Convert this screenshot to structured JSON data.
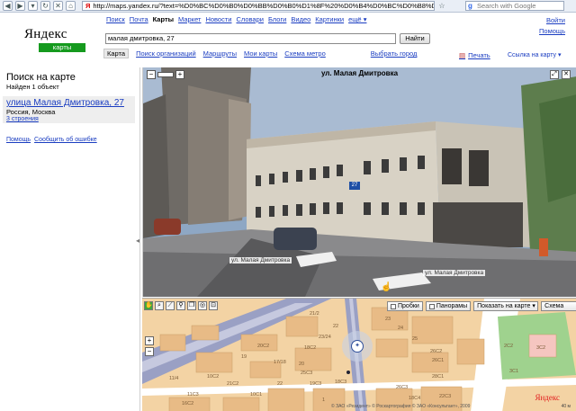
{
  "browser": {
    "url": "http://maps.yandex.ru/?text=%D0%BC%D0%B0%D0%BB%D0%B0%D1%8F%20%D0%B4%D0%BC%D0%B8%D1%82%D1",
    "search_placeholder": "Search with Google",
    "search_engine_letter": "g"
  },
  "header": {
    "services": [
      {
        "label": "Поиск",
        "active": false
      },
      {
        "label": "Почта",
        "active": false
      },
      {
        "label": "Карты",
        "active": true
      },
      {
        "label": "Маркет",
        "active": false
      },
      {
        "label": "Новости",
        "active": false
      },
      {
        "label": "Словари",
        "active": false
      },
      {
        "label": "Блоги",
        "active": false
      },
      {
        "label": "Видео",
        "active": false
      },
      {
        "label": "Картинки",
        "active": false
      },
      {
        "label": "ещё ▾",
        "active": false
      }
    ],
    "login": "Войти",
    "help": "Помощь",
    "logo_word": "Яндекс",
    "logo_sub": "карты"
  },
  "search": {
    "query": "малая дмитровка, 27",
    "button": "Найти"
  },
  "tabs": [
    {
      "label": "Карта",
      "active": true
    },
    {
      "label": "Поиск организаций",
      "active": false
    },
    {
      "label": "Маршруты",
      "active": false
    },
    {
      "label": "Мои карты",
      "active": false
    },
    {
      "label": "Схема метро",
      "active": false
    }
  ],
  "choose_city": "Выбрать город",
  "print": "Печать",
  "link_to_map": "Ссылка на карту ▾",
  "sidebar": {
    "title": "Поиск на карте",
    "found": "Найден 1 объект",
    "result_title": "улица Малая Дмитровка, 27",
    "result_city": "Россия, Москва",
    "result_buildings": "3 строения",
    "help": "Помощь",
    "report": "Сообщить об ошибке"
  },
  "panorama": {
    "title": "ул. Малая Дмитровка",
    "street_label_1": "ул. Малая Дмитровка",
    "street_label_2": "ул. Малая Дмитровка",
    "house_number": "27",
    "zoom_minus": "−",
    "zoom_plus": "+"
  },
  "map": {
    "traffic": "Пробки",
    "panoramas": "Панорамы",
    "show_on_map": "Показать на карте",
    "layer": "Схема",
    "zoom_plus": "+",
    "zoom_minus": "−",
    "copyright": "© ЗАО «Резидент»  © Роскартография  © ЗАО «Консультант», 2009",
    "scale": "40 м",
    "logo": "Яндекс",
    "building_labels": [
      "21/2",
      "22",
      "23/24",
      "23",
      "24",
      "25",
      "26C2",
      "26C1",
      "28C1",
      "20C2",
      "19",
      "18C2",
      "17/18",
      "20",
      "25C3",
      "19C3",
      "18C3",
      "26C3",
      "18C4",
      "2C2",
      "3C2",
      "3C1",
      "11/4",
      "10C2",
      "21C2",
      "11C3",
      "10C1",
      "22",
      "1",
      "16C2",
      "22C3"
    ]
  }
}
